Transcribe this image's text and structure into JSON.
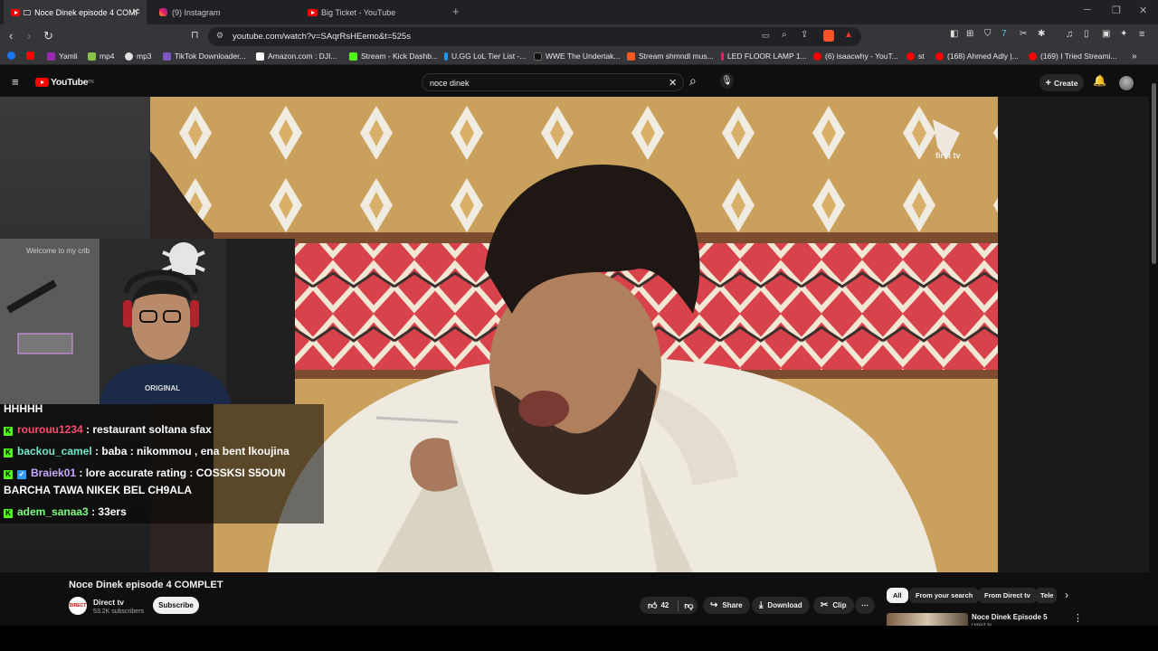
{
  "tabs": [
    {
      "title": "Noce Dinek episode 4 COMPL",
      "icon": "youtube-icon",
      "active": true
    },
    {
      "title": "(9) Instagram",
      "icon": "instagram-icon",
      "active": false
    },
    {
      "title": "Big Ticket - YouTube",
      "icon": "youtube-icon",
      "active": false
    }
  ],
  "address": {
    "url": "youtube.com/watch?v=SAqrRsHEemo&t=525s"
  },
  "bookmarks": [
    {
      "label": "",
      "color": "#1877f2"
    },
    {
      "label": "",
      "color": "#ff0000"
    },
    {
      "label": "Yamli",
      "color": "#9c27b0"
    },
    {
      "label": "mp4",
      "color": "#8bc34a"
    },
    {
      "label": "mp3",
      "color": "#e0e0e0"
    },
    {
      "label": "TikTok Downloader...",
      "color": "#7e57c2"
    },
    {
      "label": "Amazon.com : DJI...",
      "color": "#ffffff"
    },
    {
      "label": "Stream - Kick Dashb...",
      "color": "#53fc18"
    },
    {
      "label": "U.GG LoL Tier List -...",
      "color": "#2196f3"
    },
    {
      "label": "WWE The Undertak...",
      "color": "#111111"
    },
    {
      "label": "Stream shmndl mus...",
      "color": "#ff5722"
    },
    {
      "label": "LED FLOOR LAMP 1...",
      "color": "#e91e63"
    },
    {
      "label": "(6) isaacwhy - YouT...",
      "color": "#ff0000"
    },
    {
      "label": "st",
      "color": "#ff0000"
    },
    {
      "label": "(168) Ahmed Adly |...",
      "color": "#ff0000"
    },
    {
      "label": "(169) I Tried Streami...",
      "color": "#ff0000"
    }
  ],
  "youtube": {
    "logo": "YouTube",
    "logo_sup": "TN",
    "search_value": "noce dinek",
    "create_label": "Create"
  },
  "video": {
    "watermark": "first tv",
    "title": "Noce Dinek episode 4 COMPLET"
  },
  "webcam": {
    "sign": "Welcome to my crib",
    "shirt": "ORIGINAL"
  },
  "chat": [
    {
      "user": "",
      "user_color": "#ffffff",
      "text": "HHHHH",
      "badge": false,
      "verified": false
    },
    {
      "user": "rourouu1234",
      "user_color": "#ff4d6d",
      "text": " : restaurant soltana sfax",
      "badge": true,
      "verified": false
    },
    {
      "user": "backou_camel",
      "user_color": "#6fe8c9",
      "text": " : baba : nikommou , ena bent lkoujina",
      "badge": true,
      "verified": false
    },
    {
      "user": "Braiek01",
      "user_color": "#c9a6ff",
      "text": " : lore accurate rating : COSSKSI S5OUN",
      "badge": true,
      "verified": true
    },
    {
      "user": "",
      "user_color": "#ffffff",
      "text": "BARCHA TAWA NIKEK BEL CH9ALA",
      "badge": false,
      "verified": false
    },
    {
      "user": "adem_sanaa3",
      "user_color": "#7cff7c",
      "text": " : 33ers",
      "badge": true,
      "verified": false
    }
  ],
  "channel": {
    "avatar_text": "DIRECT",
    "name": "Direct tv",
    "subscribers": "53.2K subscribers",
    "subscribe_label": "Subscribe"
  },
  "actions": {
    "likes": "42",
    "share": "Share",
    "download": "Download",
    "clip": "Clip"
  },
  "filter_chips": [
    "All",
    "From your search",
    "From Direct tv",
    "Tele"
  ],
  "recommended": {
    "title": "Noce Dinek Episode 5",
    "channel": "Direct tv"
  }
}
